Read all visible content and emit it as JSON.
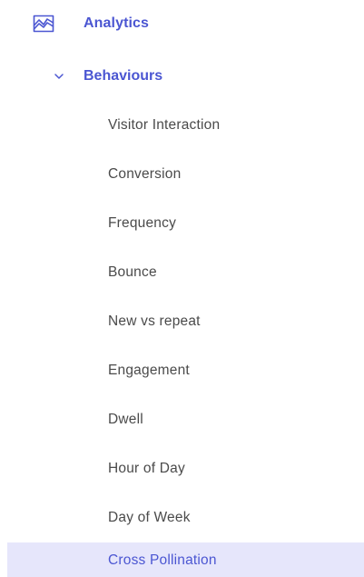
{
  "nav": {
    "section": {
      "label": "Analytics",
      "icon": "analytics-chart-icon",
      "accent_color": "#4b56d2"
    },
    "group": {
      "label": "Behaviours",
      "icon": "chevron-down-icon",
      "expanded": true
    },
    "items": [
      {
        "label": "Visitor Interaction",
        "active": false
      },
      {
        "label": "Conversion",
        "active": false
      },
      {
        "label": "Frequency",
        "active": false
      },
      {
        "label": "Bounce",
        "active": false
      },
      {
        "label": "New vs repeat",
        "active": false
      },
      {
        "label": "Engagement",
        "active": false
      },
      {
        "label": "Dwell",
        "active": false
      },
      {
        "label": "Hour of Day",
        "active": false
      },
      {
        "label": "Day of Week",
        "active": false
      },
      {
        "label": "Cross Pollination",
        "active": true
      }
    ],
    "active_bg_color": "#e6e6fb"
  }
}
